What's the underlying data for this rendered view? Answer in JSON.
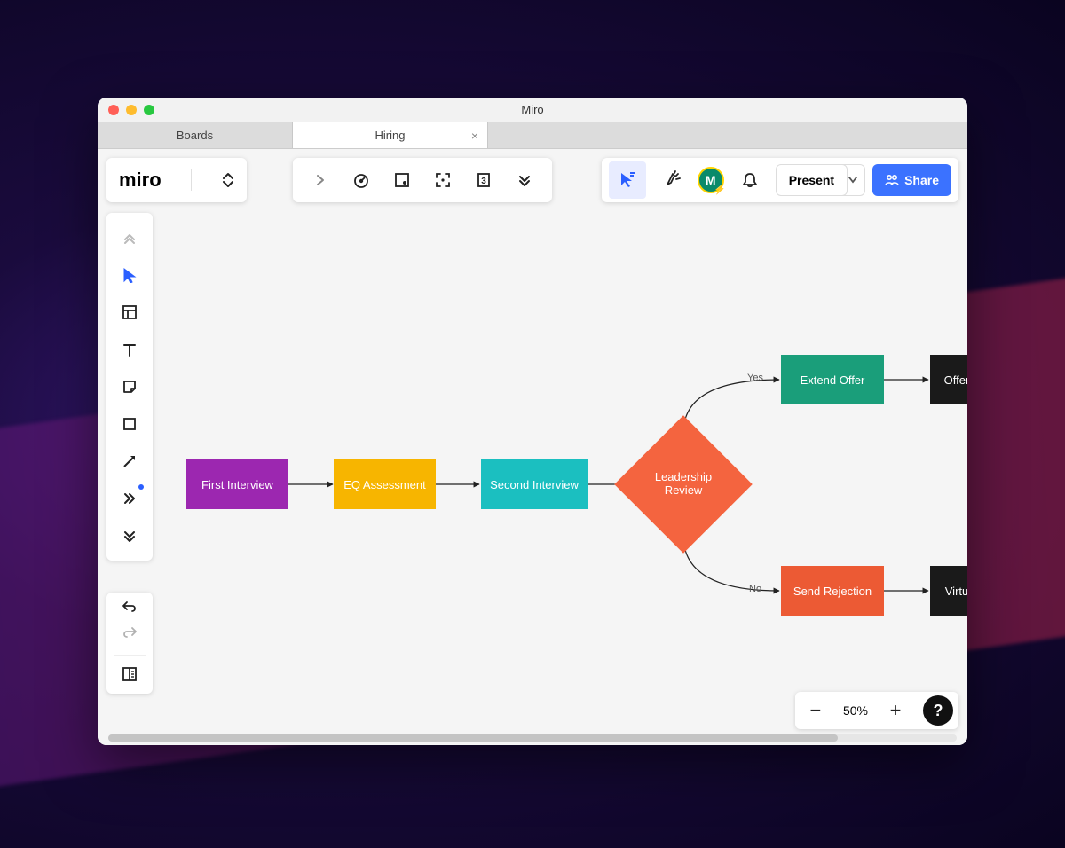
{
  "window": {
    "title": "Miro"
  },
  "tabs": [
    {
      "label": "Boards",
      "active": false
    },
    {
      "label": "Hiring",
      "active": true
    }
  ],
  "logo": {
    "text": "miro"
  },
  "center_toolbar": {
    "expand_icon": "chevron-right",
    "timer_icon": "timer",
    "frame_icon": "frame-dot",
    "fit_icon": "fit",
    "count_icon": "3",
    "more_icon": "chevrons-down"
  },
  "right_toolbar": {
    "cursor_icon": "cursor-lines",
    "reactions_icon": "party",
    "avatar_initial": "M",
    "bell_icon": "bell",
    "present_label": "Present",
    "share_label": "Share"
  },
  "tools": [
    {
      "name": "collapse",
      "icon": "chevrons-up"
    },
    {
      "name": "select",
      "icon": "cursor",
      "active": true
    },
    {
      "name": "templates",
      "icon": "template"
    },
    {
      "name": "text",
      "icon": "text"
    },
    {
      "name": "sticky",
      "icon": "sticky"
    },
    {
      "name": "shape",
      "icon": "square"
    },
    {
      "name": "line",
      "icon": "arrow"
    },
    {
      "name": "more",
      "icon": "chevrons-right",
      "dot": true
    },
    {
      "name": "expand",
      "icon": "chevrons-down"
    }
  ],
  "tools2": [
    {
      "name": "undo",
      "icon": "undo"
    },
    {
      "name": "redo",
      "icon": "redo",
      "disabled": true
    },
    {
      "name": "panel",
      "icon": "panel"
    }
  ],
  "flow": {
    "nodes": {
      "first_interview": "First Interview",
      "eq_assessment": "EQ Assessment",
      "second_interview": "Second Interview",
      "leadership_review": "Leadership Review",
      "extend_offer": "Extend Offer",
      "send_rejection": "Send Rejection",
      "offer": "Offer ",
      "virtual": "Virtu"
    },
    "edge_labels": {
      "yes": "Yes",
      "no": "No"
    }
  },
  "zoom": {
    "value": "50%"
  }
}
